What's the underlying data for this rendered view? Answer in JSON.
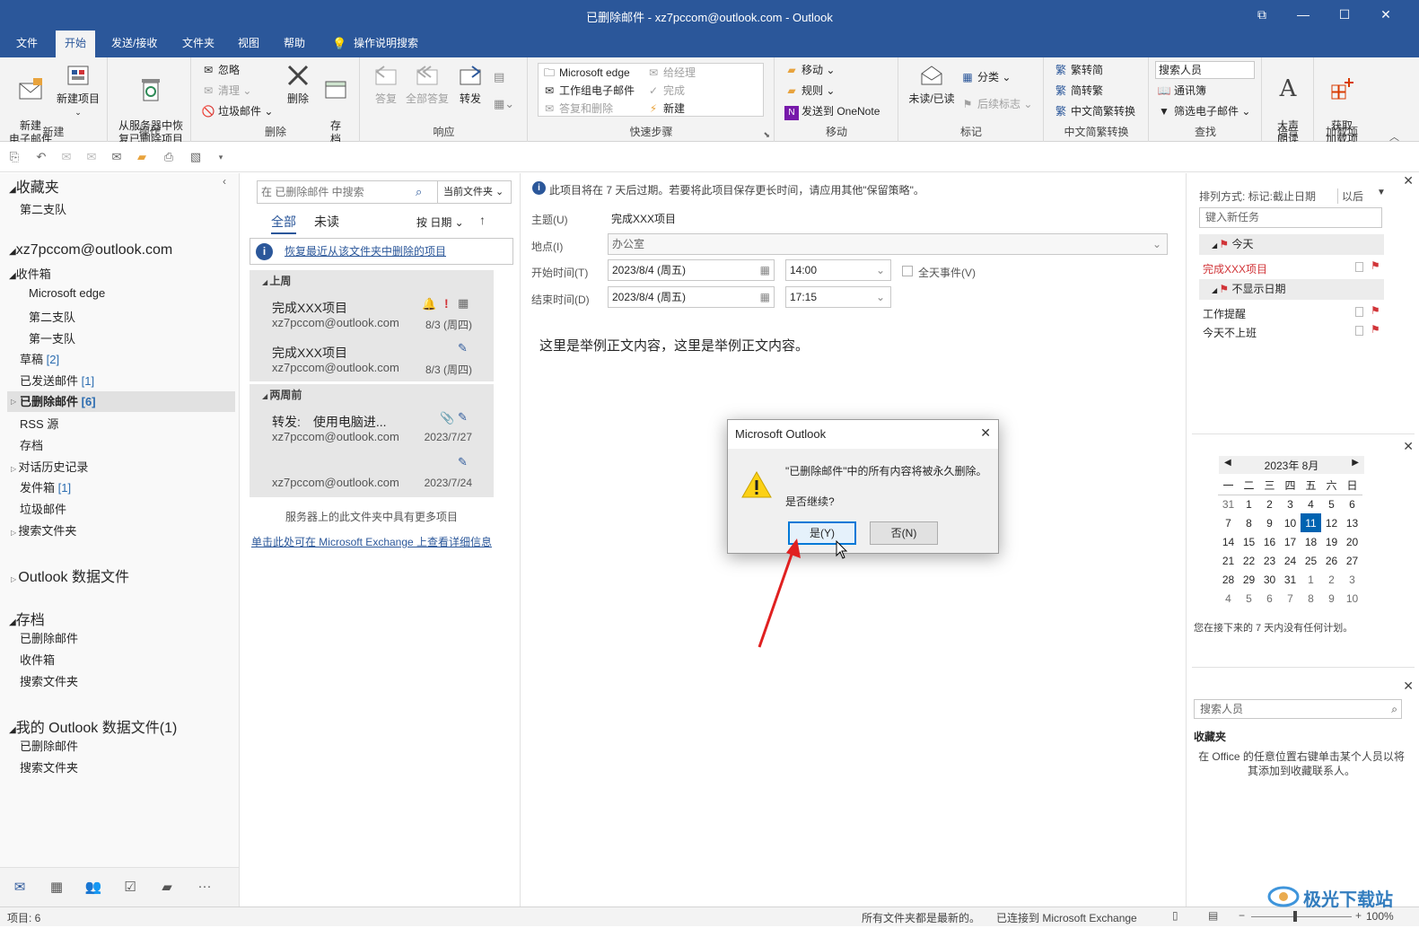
{
  "window": {
    "title": "已删除邮件 - xz7pccom@outlook.com  -  Outlook",
    "controls": [
      "restore-icon",
      "minimize-icon",
      "maximize-icon",
      "close-icon"
    ]
  },
  "tabs": [
    {
      "label": "文件"
    },
    {
      "label": "开始"
    },
    {
      "label": "发送/接收"
    },
    {
      "label": "文件夹"
    },
    {
      "label": "视图"
    },
    {
      "label": "帮助"
    },
    {
      "label": "操作说明搜索"
    }
  ],
  "ribbon": {
    "new_group": {
      "label": "新建",
      "new_email": "新建\n电子邮件",
      "new_item": "新建项目"
    },
    "ops_group": {
      "label": "操作",
      "recover": "从服务器中恢\n复已删除项目"
    },
    "delete_group": {
      "label": "删除",
      "ignore": "忽略",
      "clean": "清理",
      "junk": "垃圾邮件",
      "delete": "删除",
      "archive": "存\n档"
    },
    "respond_group": {
      "label": "响应",
      "reply": "答复",
      "reply_all": "全部答复",
      "forward": "转发"
    },
    "quick_group": {
      "label": "快速步骤",
      "items": [
        "Microsoft edge",
        "给经理",
        "工作组电子邮件",
        "完成",
        "答复和删除",
        "新建"
      ]
    },
    "move_group": {
      "label": "移动",
      "move": "移动",
      "rules": "规则",
      "onenote": "发送到 OneNote"
    },
    "tags_group": {
      "label": "标记",
      "unread": "未读/已读",
      "categorize": "分类",
      "followup": "后续标志"
    },
    "chinese_group": {
      "label": "中文简繁转换",
      "to_trad": "繁转简",
      "to_simp": "简转繁",
      "convert": "中文简繁转换"
    },
    "find_group": {
      "label": "查找",
      "search_people": "搜索人员",
      "address_book": "通讯簿",
      "filter": "筛选电子邮件"
    },
    "speech_group": {
      "label": "语音",
      "read_aloud": "大声\n朗读"
    },
    "addins_group": {
      "label": "加载项",
      "get_addins": "获取\n加载项"
    }
  },
  "nav": {
    "favorites": "收藏夹",
    "fav_item": "第二支队",
    "account": "xz7pccom@outlook.com",
    "inbox": "收件箱",
    "sub1": "Microsoft edge",
    "sub2": "第二支队",
    "sub3": "第一支队",
    "drafts": "草稿",
    "drafts_count": "[2]",
    "sent": "已发送邮件",
    "sent_count": "[1]",
    "deleted": "已删除邮件",
    "deleted_count": "[6]",
    "rss": "RSS 源",
    "archive": "存档",
    "history": "对话历史记录",
    "outbox": "发件箱",
    "outbox_count": "[1]",
    "junk": "垃圾邮件",
    "search_folders": "搜索文件夹",
    "data_file": "Outlook 数据文件",
    "archive_root": "存档",
    "ar_deleted": "已删除邮件",
    "ar_inbox": "收件箱",
    "ar_search": "搜索文件夹",
    "my_data": "我的 Outlook 数据文件(1)",
    "md_deleted": "已删除邮件",
    "md_search": "搜索文件夹"
  },
  "list": {
    "search_placeholder": "在 已删除邮件 中搜索",
    "scope": "当前文件夹",
    "filter_all": "全部",
    "filter_unread": "未读",
    "sort": "按 日期",
    "recover_link": "恢复最近从该文件夹中删除的项目",
    "section1": "上周",
    "section2": "两周前",
    "items": [
      {
        "subject": "完成XXX项目",
        "from": "xz7pccom@outlook.com",
        "date": "8/3 (周四)"
      },
      {
        "subject": "完成XXX项目",
        "from": "xz7pccom@outlook.com",
        "date": "8/3 (周四)"
      },
      {
        "subject": "转发:　使用电脑进...",
        "from": "xz7pccom@outlook.com",
        "date": "2023/7/27"
      },
      {
        "subject": "",
        "from": "xz7pccom@outlook.com",
        "date": "2023/7/24"
      }
    ],
    "more_note": "服务器上的此文件夹中具有更多项目",
    "exchange_link": "单击此处可在 Microsoft Exchange 上查看详细信息"
  },
  "reading": {
    "info": "此项目将在 7 天后过期。若要将此项目保存更长时间，请应用其他\"保留策略\"。",
    "subject_label": "主题(U)",
    "subject": "完成XXX项目",
    "location_label": "地点(I)",
    "location": "办公室",
    "start_label": "开始时间(T)",
    "start_date": "2023/8/4 (周五)",
    "start_time": "14:00",
    "allday": "全天事件(V)",
    "end_label": "结束时间(D)",
    "end_date": "2023/8/4 (周五)",
    "end_time": "17:15",
    "body": "这里是举例正文内容，这里是举例正文内容。"
  },
  "todo": {
    "sort": "排列方式: 标记:截止日期",
    "sort_dir": "以后",
    "new_task": "键入新任务",
    "today": "今天",
    "task1": "完成XXX项目",
    "nodate": "不显示日期",
    "task2": "工作提醒",
    "task3": "今天不上班",
    "cal_title": "2023年 8月",
    "weekdays": [
      "一",
      "二",
      "三",
      "四",
      "五",
      "六",
      "日"
    ],
    "weeks": [
      [
        "31",
        "1",
        "2",
        "3",
        "4",
        "5",
        "6"
      ],
      [
        "7",
        "8",
        "9",
        "10",
        "11",
        "12",
        "13"
      ],
      [
        "14",
        "15",
        "16",
        "17",
        "18",
        "19",
        "20"
      ],
      [
        "21",
        "22",
        "23",
        "24",
        "25",
        "26",
        "27"
      ],
      [
        "28",
        "29",
        "30",
        "31",
        "1",
        "2",
        "3"
      ],
      [
        "4",
        "5",
        "6",
        "7",
        "8",
        "9",
        "10"
      ]
    ],
    "no_plan": "您在接下来的 7 天内没有任何计划。",
    "people_search": "搜索人员",
    "fav_title": "收藏夹",
    "fav_hint": "在 Office 的任意位置右键单击某个人员以将其添加到收藏联系人。"
  },
  "dialog": {
    "title": "Microsoft Outlook",
    "message": "\"已删除邮件\"中的所有内容将被永久删除。",
    "question": "是否继续?",
    "yes": "是(Y)",
    "no": "否(N)"
  },
  "status": {
    "items": "项目: 6",
    "folders": "所有文件夹都是最新的。",
    "connected": "已连接到 Microsoft Exchange",
    "zoom": "100%"
  },
  "watermark": "极光下载站",
  "colors": {
    "brand": "#2b579a",
    "accent": "#0063b1",
    "flag": "#d13438",
    "arrow": "#e02020"
  }
}
